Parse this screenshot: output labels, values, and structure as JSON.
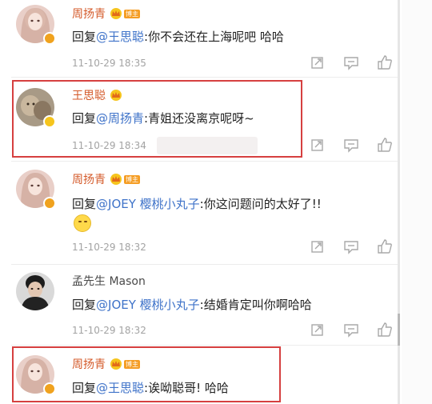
{
  "reply_prefix": "回复",
  "comments": [
    {
      "user": "周扬青",
      "crown_badge": "crown-icon",
      "level_badge": "博主",
      "mention": "@王思聪",
      "text": ":你不会还在上海呢吧 哈哈",
      "time": "11-10-29 18:35",
      "verified_color": "#f0a21e",
      "highlighted": false
    },
    {
      "user": "王思聪",
      "crown_badge": "crown-icon",
      "mention": "@周扬青",
      "text": ":青姐还没离京呢呀~",
      "time": "11-10-29 18:34",
      "verified_color": "#f6c51d",
      "highlighted": true,
      "time_obscured": true
    },
    {
      "user": "周扬青",
      "crown_badge": "crown-icon",
      "level_badge": "博主",
      "mention": "@JOEY 樱桃小丸子",
      "text": ":你这问题问的太好了!!",
      "emoji": "grin-emoji",
      "time": "11-10-29 18:32",
      "verified_color": "#f0a21e",
      "highlighted": false
    },
    {
      "user": "孟先生 Mason",
      "mention": "@JOEY 樱桃小丸子",
      "text": ":结婚肯定叫你啊哈哈",
      "time": "11-10-29 18:32",
      "highlighted": false
    },
    {
      "user": "周扬青",
      "crown_badge": "crown-icon",
      "level_badge": "博主",
      "mention": "@王思聪",
      "text": ":诶呦聪哥! 哈哈",
      "verified_color": "#f0a21e",
      "highlighted": true
    }
  ],
  "actions": [
    "forward-icon",
    "comment-icon",
    "like-icon"
  ],
  "colors": {
    "highlight": "#d64040",
    "mention": "#3f73c9",
    "name_accent": "#d45a2a",
    "timestamp": "#a3a3a3"
  }
}
